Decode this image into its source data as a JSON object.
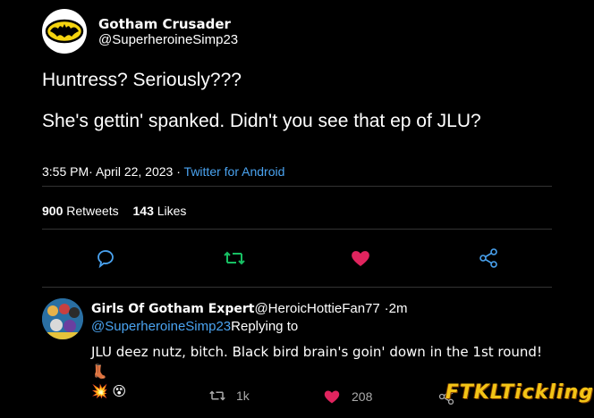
{
  "tweet": {
    "display_name": "Gotham Crusader",
    "handle": "@SuperheroineSimp23",
    "line1": "Huntress? Seriously???",
    "line2": "She's gettin' spanked. Didn't you see that ep of JLU?",
    "time": "3:55 PM",
    "date": "April 22, 2023",
    "sep": "·",
    "client": "Twitter for Android",
    "retweets_count": "900",
    "retweets_label": "Retweets",
    "likes_count": "143",
    "likes_label": "Likes"
  },
  "actions": {
    "reply_icon": "speech-bubble-icon",
    "retweet_icon": "retweet-icon",
    "like_icon": "heart-icon",
    "share_icon": "share-icon"
  },
  "reply": {
    "display_name": "Girls Of Gotham Expert",
    "handle": "@HeroicHottieFan77",
    "age": "·2m",
    "mention": "@SuperheroineSimp23",
    "replying_to": "Replying to",
    "body": "JLU deez nutz, bitch. Black bird brain's goin' down in the 1st round! 👢",
    "emojis": "💥 😵",
    "retweets": "1k",
    "likes": "208"
  },
  "watermark": "FTKLTickling",
  "colors": {
    "background": "#000000",
    "link": "#4aa3f0",
    "retweet_green": "#17bf63",
    "like_red": "#e0245e",
    "icon_blue": "#4aa3f0"
  }
}
